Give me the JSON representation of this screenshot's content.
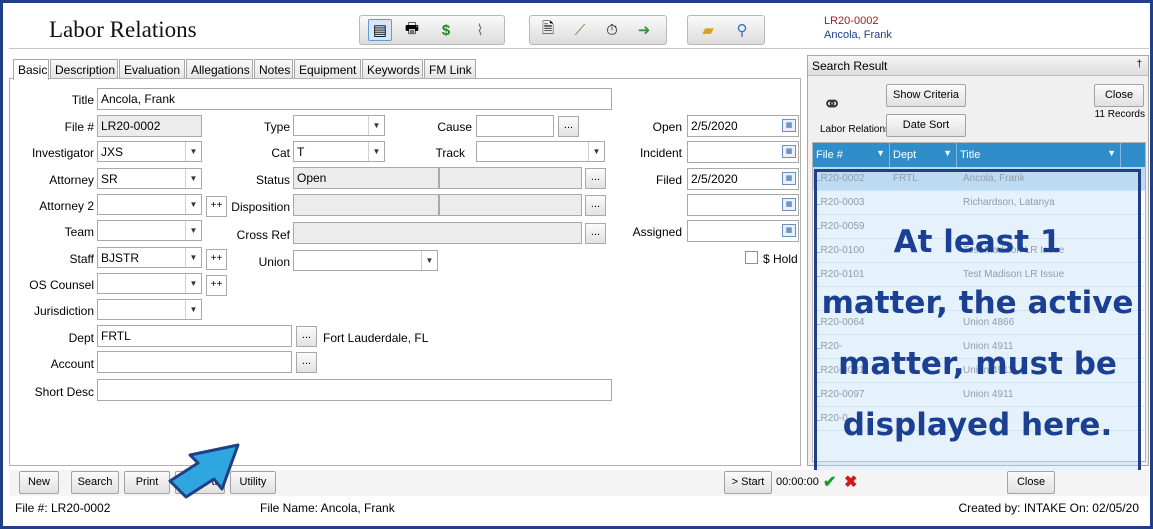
{
  "header": {
    "title": "Labor Relations",
    "file_number": "LR20-0002",
    "file_name": "Ancola, Frank",
    "toolbar_icons": [
      "form-view-icon",
      "printer-icon",
      "dollar-icon",
      "paperclip-icon",
      "document-search-icon",
      "chart-icon",
      "stopwatch-icon",
      "export-icon",
      "folder-icon",
      "magnifier-icon"
    ]
  },
  "tabs": [
    "Basic",
    "Description",
    "Evaluation",
    "Allegations",
    "Notes",
    "Equipment",
    "Keywords",
    "FM Link"
  ],
  "form": {
    "title_label": "Title",
    "title_value": "Ancola, Frank",
    "file_label": "File #",
    "file_value": "LR20-0002",
    "investigator_label": "Investigator",
    "investigator_value": "JXS",
    "attorney_label": "Attorney",
    "attorney_value": "SR",
    "attorney2_label": "Attorney 2",
    "attorney2_value": "",
    "team_label": "Team",
    "team_value": "",
    "staff_label": "Staff",
    "staff_value": "BJSTR",
    "os_counsel_label": "OS Counsel",
    "os_counsel_value": "",
    "jurisdiction_label": "Jurisdiction",
    "jurisdiction_value": "",
    "dept_label": "Dept",
    "dept_value": "FRTL",
    "dept_desc": "Fort Lauderdale, FL",
    "account_label": "Account",
    "account_value": "",
    "short_desc_label": "Short Desc",
    "short_desc_value": "",
    "type_label": "Type",
    "type_value": "",
    "cat_label": "Cat",
    "cat_value": "T",
    "status_label": "Status",
    "status_value": "Open",
    "disposition_label": "Disposition",
    "disposition_value": "",
    "cross_ref_label": "Cross Ref",
    "cross_ref_value": "",
    "union_label": "Union",
    "union_value": "",
    "cause_label": "Cause",
    "cause_value": "",
    "track_label": "Track",
    "track_value": "",
    "open_label": "Open",
    "open_value": "2/5/2020",
    "incident_label": "Incident",
    "incident_value": "",
    "filed_label": "Filed",
    "filed_value": "2/5/2020",
    "extra_date_value": "",
    "assigned_label": "Assigned",
    "assigned_value": "",
    "hold_label": "$ Hold",
    "plus_label": "++",
    "dots_label": "..."
  },
  "search_result": {
    "title": "Search Result",
    "pin_glyph": "†",
    "icon_caption": "Labor Relations",
    "show_criteria": "Show Criteria",
    "date_sort": "Date Sort",
    "close": "Close",
    "records": "11 Records",
    "columns": [
      "File #",
      "Dept",
      "Title"
    ],
    "rows": [
      {
        "file": "LR20-0002",
        "dept": "FRTL",
        "title": "Ancola, Frank"
      },
      {
        "file": "LR20-0003",
        "dept": "",
        "title": "Richardson, Latanya"
      },
      {
        "file": "LR20-0059",
        "dept": "",
        "title": ""
      },
      {
        "file": "LR20-0100",
        "dept": "",
        "title": "Test Madison LR Issue"
      },
      {
        "file": "LR20-0101",
        "dept": "",
        "title": "Test Madison LR Issue"
      },
      {
        "file": "",
        "dept": "",
        "title": ""
      },
      {
        "file": "LR20-0064",
        "dept": "",
        "title": "Union 4866"
      },
      {
        "file": "LR20-",
        "dept": "",
        "title": "Union 4911"
      },
      {
        "file": "LR20-0091",
        "dept": "",
        "title": "Union 4911"
      },
      {
        "file": "LR20-0097",
        "dept": "",
        "title": "Union 4911"
      },
      {
        "file": "LR20-0",
        "dept": "",
        "title": ""
      }
    ]
  },
  "callout": {
    "line1": "At least 1",
    "line2": "matter, the active",
    "line3": "matter, must be",
    "line4": "displayed here."
  },
  "bottom": {
    "new": "New",
    "search": "Search",
    "print": "Print",
    "reports_fragment": "ts",
    "utility": "Utility",
    "start": "> Start",
    "timer": "00:00:00",
    "close": "Close"
  },
  "status": {
    "file": "File #: LR20-0002",
    "file_name": "File Name: Ancola, Frank",
    "created": "Created by: INTAKE On: 02/05/20"
  },
  "colors": {
    "frame": "#1f3f86",
    "grid_header": "#2f8ec9",
    "accent_red": "#9b1c1c",
    "callout_text": "#1a3f93"
  }
}
